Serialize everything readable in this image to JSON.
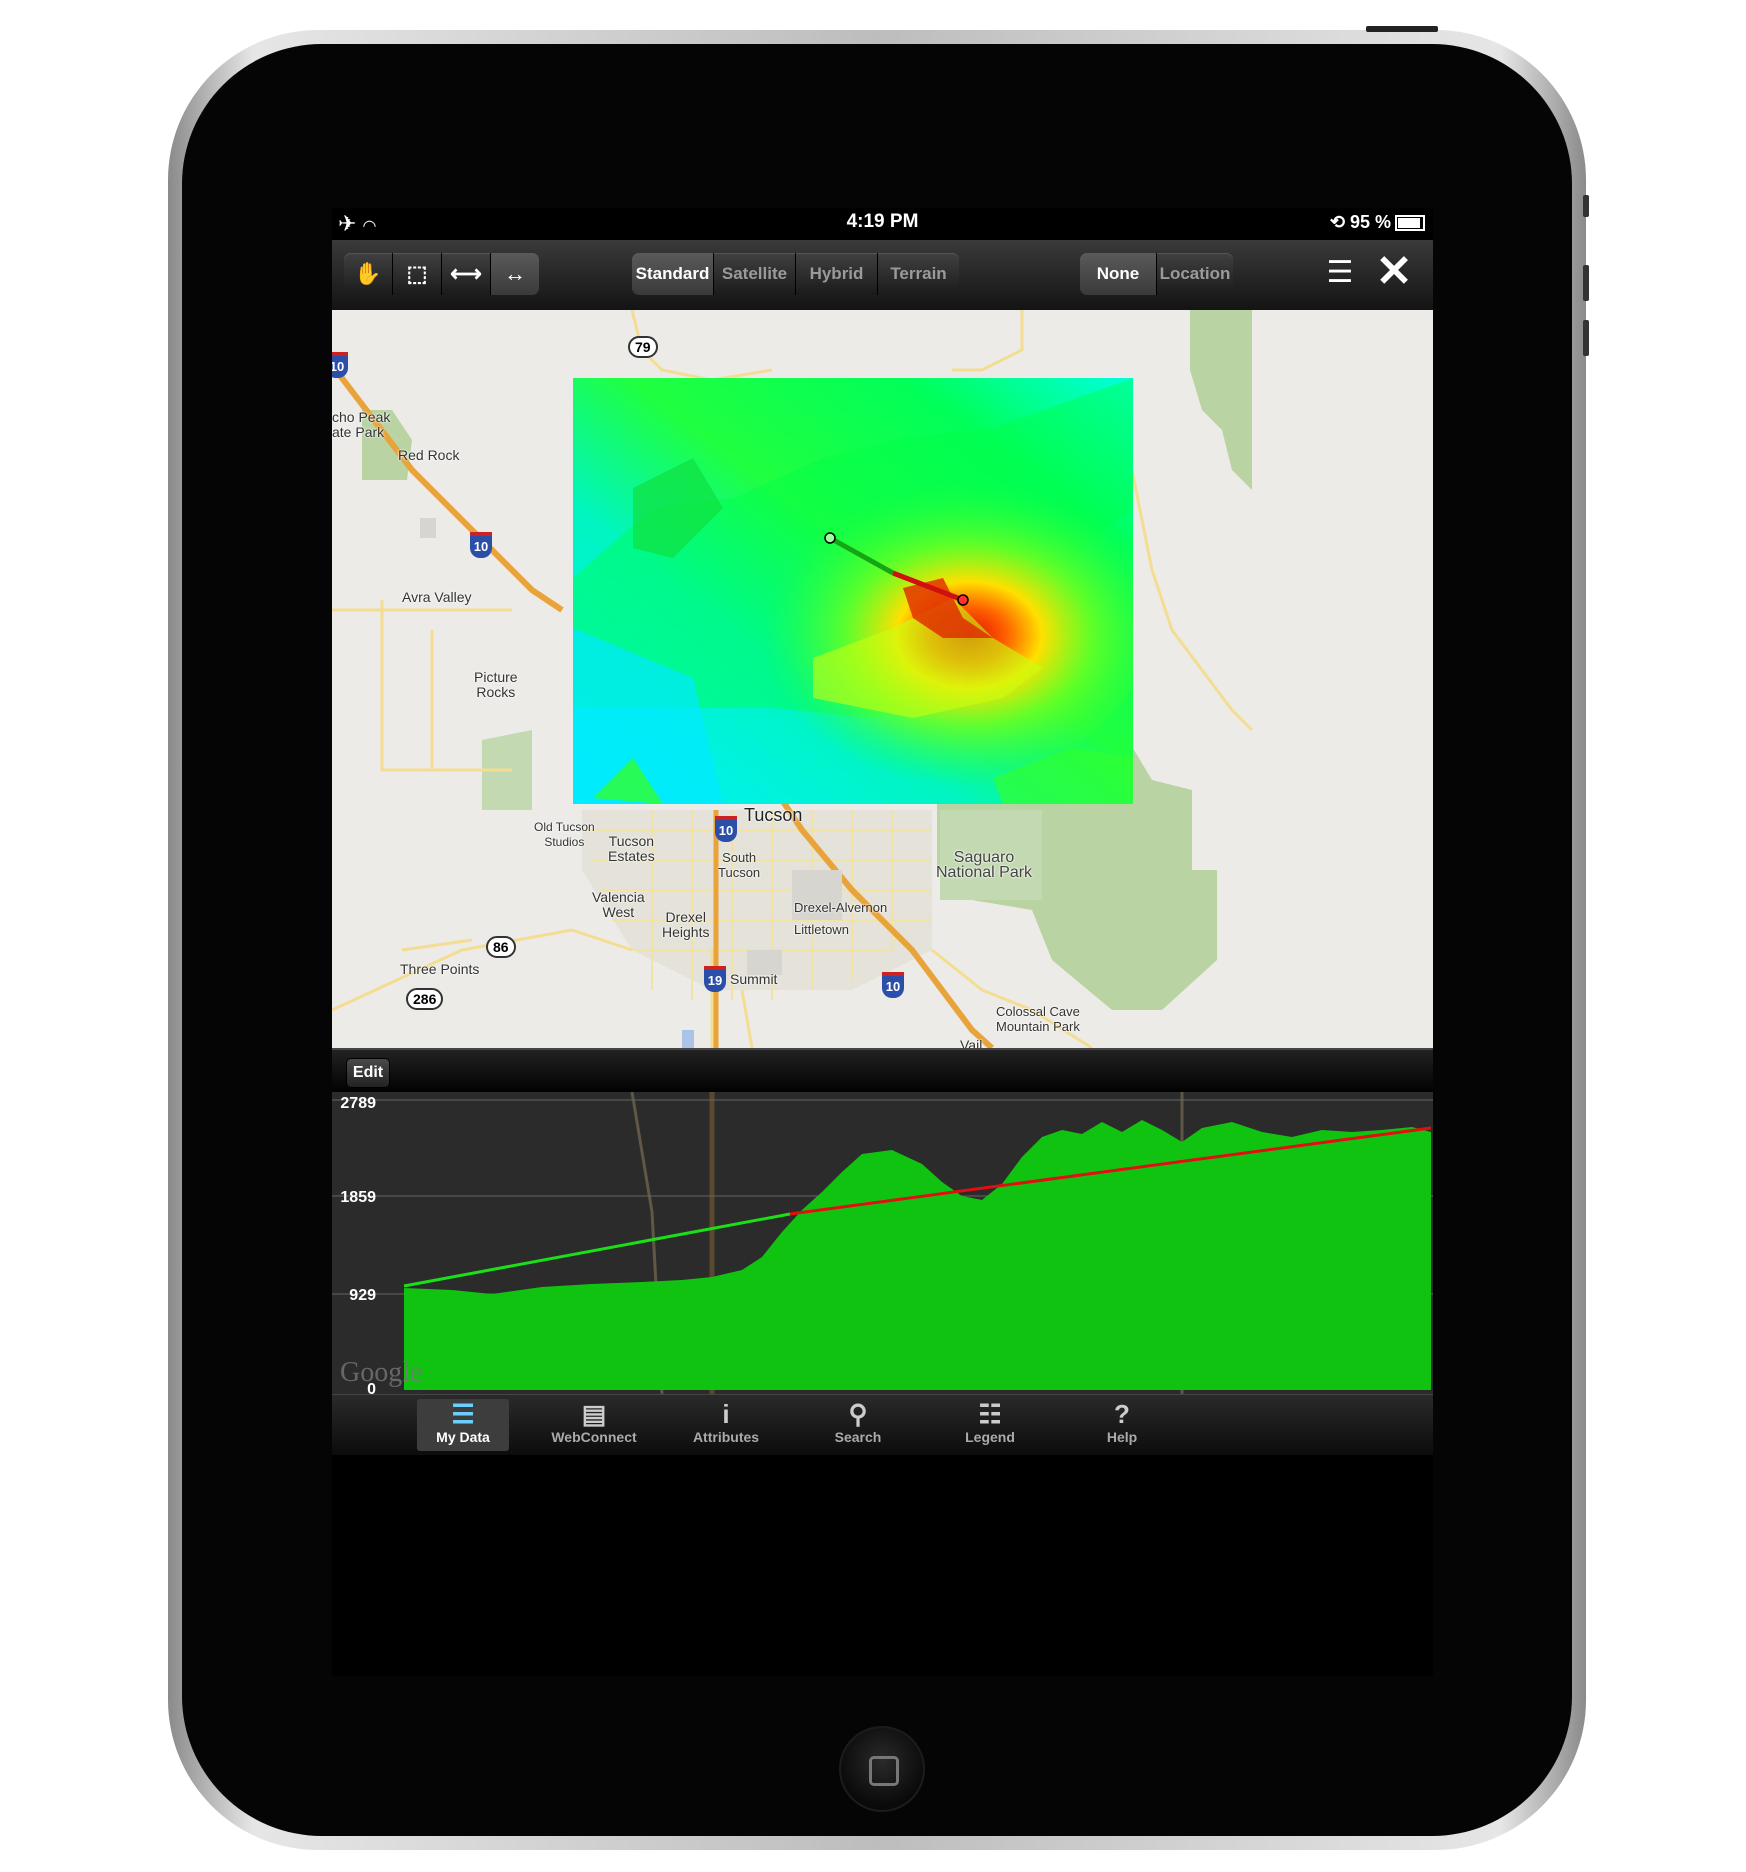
{
  "status_bar": {
    "time": "4:19 PM",
    "battery": "95 %"
  },
  "toolbar": {
    "tools": [
      {
        "name": "pan-tool-button",
        "glyph": "✋",
        "active": false
      },
      {
        "name": "select-tool-button",
        "glyph": "⬚",
        "active": false
      },
      {
        "name": "measure-tool-button",
        "glyph": "⟷",
        "active": false
      },
      {
        "name": "profile-tool-button",
        "glyph": "↔",
        "active": true
      }
    ],
    "map_types": [
      {
        "label": "Standard",
        "active": true
      },
      {
        "label": "Satellite",
        "active": false
      },
      {
        "label": "Hybrid",
        "active": false
      },
      {
        "label": "Terrain",
        "active": false
      }
    ],
    "overlays": [
      {
        "label": "None",
        "active": true
      },
      {
        "label": "Location",
        "active": false
      }
    ]
  },
  "map": {
    "places": [
      {
        "name": "Red Rock",
        "key": "red-rock"
      },
      {
        "name": "Avra Valley",
        "key": "avra-valley"
      },
      {
        "name": "Picture\nRocks",
        "key": "picture-rocks"
      },
      {
        "name": "cho Peak\nate Park",
        "key": "picacho-peak"
      },
      {
        "name": "Tucson",
        "key": "tucson"
      },
      {
        "name": "Old Tucson\nStudios",
        "key": "old-tucson"
      },
      {
        "name": "Tucson\nEstates",
        "key": "tucson-estates"
      },
      {
        "name": "South\nTucson",
        "key": "south-tucson"
      },
      {
        "name": "Valencia\nWest",
        "key": "valencia-west"
      },
      {
        "name": "Drexel\nHeights",
        "key": "drexel-heights"
      },
      {
        "name": "Drexel-Alvernon",
        "key": "drexel-alvernon"
      },
      {
        "name": "Littletown",
        "key": "littletown"
      },
      {
        "name": "Saguaro\nNational Park",
        "key": "saguaro"
      },
      {
        "name": "Three Points",
        "key": "three-points"
      },
      {
        "name": "Summit",
        "key": "summit"
      },
      {
        "name": "Colossal Cave\nMountain Park",
        "key": "colossal-cave"
      },
      {
        "name": "Vail",
        "key": "vail"
      }
    ],
    "routes": [
      {
        "label": "79",
        "type": "state"
      },
      {
        "label": "86",
        "type": "state"
      },
      {
        "label": "286",
        "type": "state"
      },
      {
        "label": "10",
        "type": "interstate"
      },
      {
        "label": "10",
        "type": "interstate"
      },
      {
        "label": "10",
        "type": "interstate"
      },
      {
        "label": "10",
        "type": "interstate"
      },
      {
        "label": "19",
        "type": "interstate"
      }
    ]
  },
  "profile_panel": {
    "edit_label": "Edit",
    "y_labels": [
      "2789",
      "1859",
      "929",
      "0"
    ],
    "watermark": "Google",
    "colors": {
      "fill": "#11c311",
      "line_visible": "#19e019",
      "line_blocked": "#e01010"
    }
  },
  "tabs": [
    {
      "label": "My Data",
      "icon": "layers-icon",
      "glyph": "☰",
      "active": true
    },
    {
      "label": "WebConnect",
      "icon": "server-icon",
      "glyph": "▤",
      "active": false
    },
    {
      "label": "Attributes",
      "icon": "info-icon",
      "glyph": "i",
      "active": false
    },
    {
      "label": "Search",
      "icon": "search-icon",
      "glyph": "⚲",
      "active": false
    },
    {
      "label": "Legend",
      "icon": "legend-icon",
      "glyph": "☷",
      "active": false
    },
    {
      "label": "Help",
      "icon": "help-icon",
      "glyph": "?",
      "active": false
    }
  ]
}
